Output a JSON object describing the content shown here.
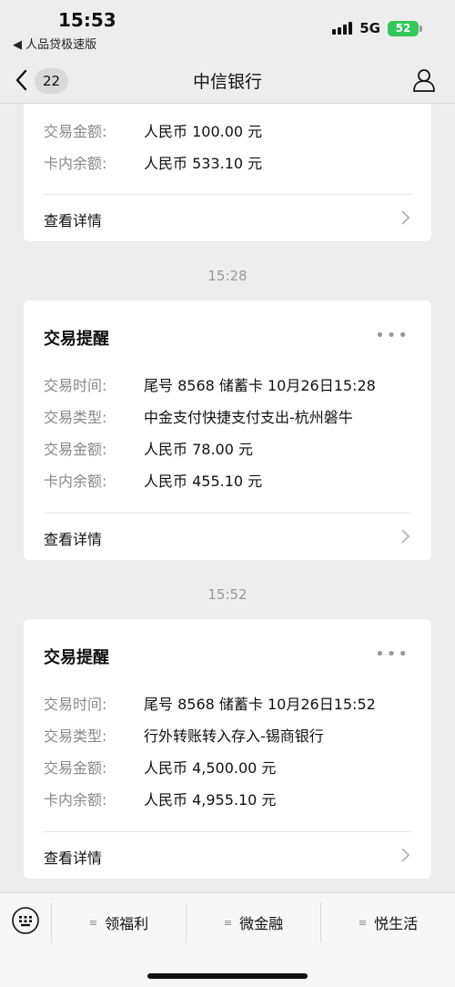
{
  "status": {
    "time": "15:53",
    "back_app": "◀ 人品贷极速版",
    "network": "5G",
    "battery": "52"
  },
  "nav": {
    "badge": "22",
    "title": "中信银行"
  },
  "card_top": {
    "rows": [
      {
        "label": "交易金额:",
        "value": "人民币 100.00 元"
      },
      {
        "label": "卡内余额:",
        "value": "人民币 533.10 元"
      }
    ],
    "detail": "查看详情"
  },
  "messages": [
    {
      "time": "15:28",
      "title": "交易提醒",
      "rows": [
        {
          "label": "交易时间:",
          "value": "尾号 8568 储蓄卡 10月26日15:28"
        },
        {
          "label": "交易类型:",
          "value": "中金支付快捷支付支出-杭州磐牛"
        },
        {
          "label": "交易金额:",
          "value": "人民币 78.00 元"
        },
        {
          "label": "卡内余额:",
          "value": "人民币 455.10 元"
        }
      ],
      "detail": "查看详情"
    },
    {
      "time": "15:52",
      "title": "交易提醒",
      "rows": [
        {
          "label": "交易时间:",
          "value": "尾号 8568 储蓄卡 10月26日15:52"
        },
        {
          "label": "交易类型:",
          "value": "行外转账转入存入-锡商银行"
        },
        {
          "label": "交易金额:",
          "value": "人民币 4,500.00 元"
        },
        {
          "label": "卡内余额:",
          "value": "人民币 4,955.10 元"
        }
      ],
      "detail": "查看详情"
    }
  ],
  "menu": [
    {
      "label": "领福利"
    },
    {
      "label": "微金融"
    },
    {
      "label": "悦生活"
    }
  ]
}
